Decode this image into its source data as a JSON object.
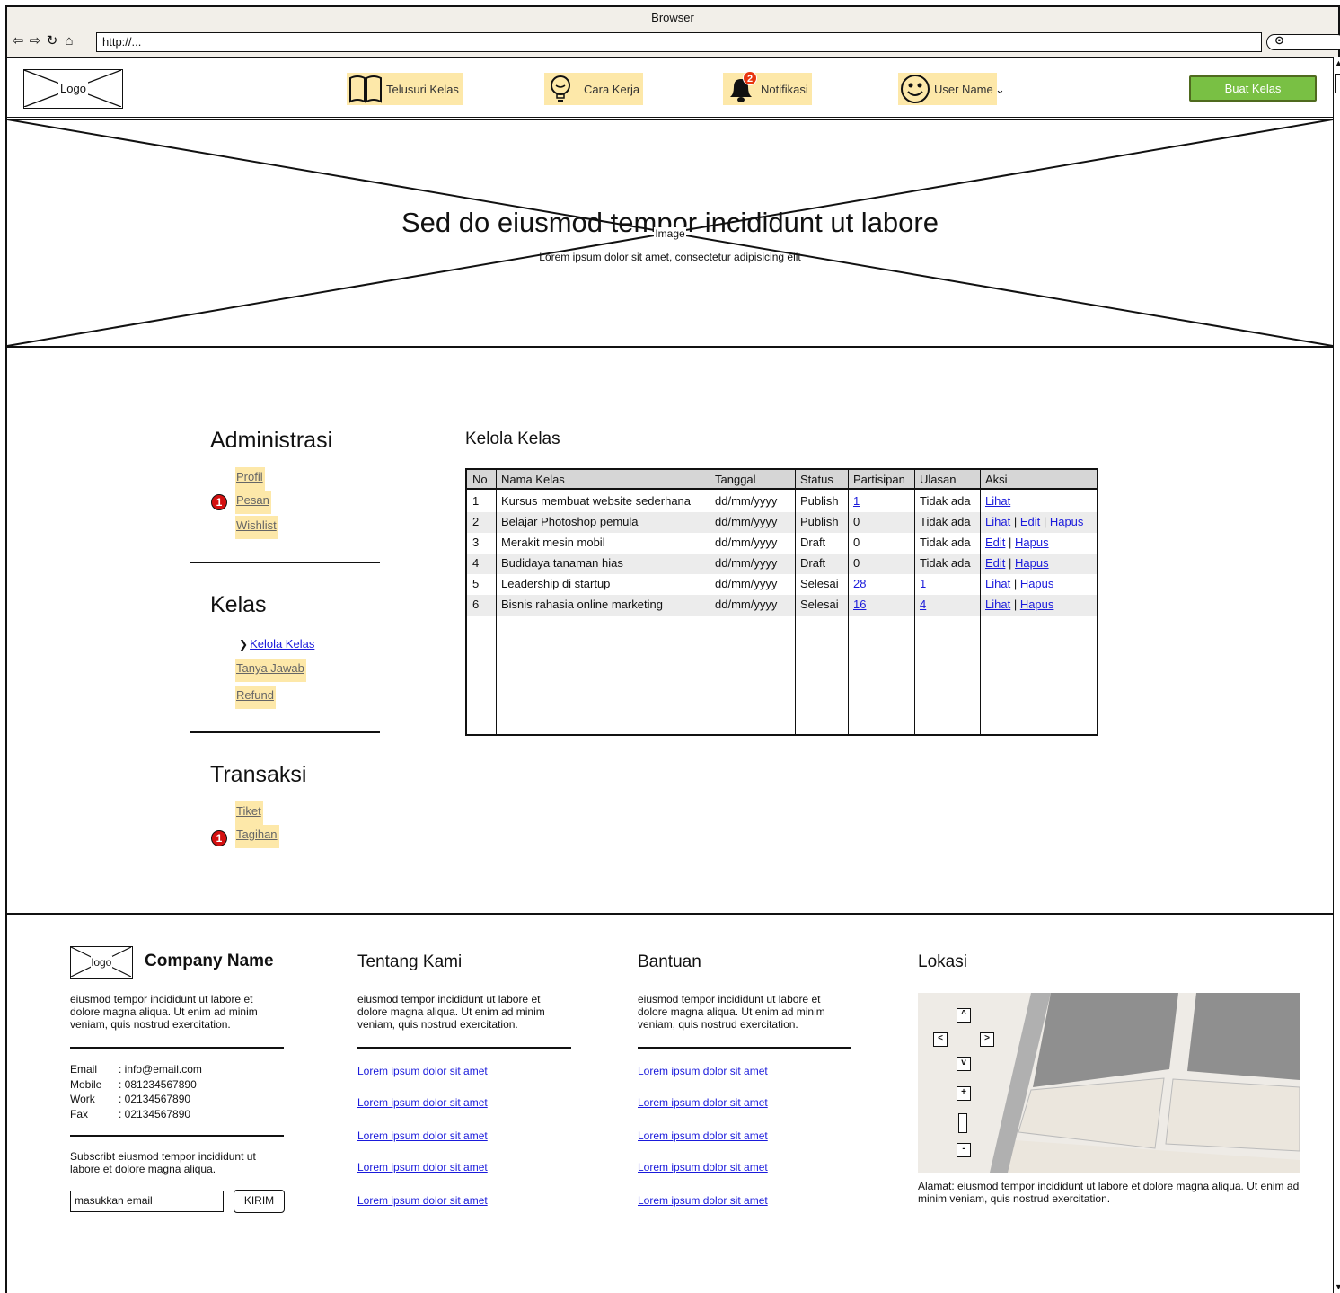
{
  "browser": {
    "title": "Browser",
    "url": "http://...",
    "nav_icons": [
      "back-arrow-icon",
      "forward-arrow-icon",
      "reload-icon",
      "home-icon"
    ],
    "search_icon": "search-icon"
  },
  "header": {
    "logo": "Logo",
    "nav": [
      {
        "label": "Telusuri Kelas",
        "icon": "book-icon"
      },
      {
        "label": "Cara Kerja",
        "icon": "lightbulb-icon"
      },
      {
        "label": "Notifikasi",
        "icon": "bell-icon",
        "badge": "2"
      },
      {
        "label": "User Name",
        "icon": "smiley-icon"
      }
    ],
    "cta": "Buat Kelas",
    "colors": {
      "nav_highlight": "#fde8a9",
      "cta": "#79c044",
      "badge": "#e8350f"
    }
  },
  "hero": {
    "title": "Sed do eiusmod tempor incididunt ut labore",
    "image_label": "Image",
    "subtitle": "Lorem ipsum dolor sit amet, consectetur adipisicing elit"
  },
  "sidebar": {
    "sections": [
      {
        "title": "Administrasi",
        "items": [
          {
            "label": "Profil"
          },
          {
            "label": "Pesan",
            "badge": "1"
          },
          {
            "label": "Wishlist"
          }
        ]
      },
      {
        "title": "Kelas",
        "items": [
          {
            "label": "Kelola Kelas",
            "active": true
          },
          {
            "label": "Tanya Jawab"
          },
          {
            "label": "Refund"
          }
        ]
      },
      {
        "title": "Transaksi",
        "items": [
          {
            "label": "Tiket"
          },
          {
            "label": "Tagihan",
            "badge": "1"
          }
        ]
      }
    ]
  },
  "main": {
    "title": "Kelola Kelas",
    "table": {
      "headers": [
        "No",
        "Nama Kelas",
        "Tanggal",
        "Status",
        "Partisipan",
        "Ulasan",
        "Aksi"
      ],
      "rows": [
        {
          "no": "1",
          "nama": "Kursus membuat website sederhana",
          "tanggal": "dd/mm/yyyy",
          "status": "Publish",
          "partisipan": "1",
          "ulasan": "Tidak ada",
          "aksi": [
            "Lihat"
          ]
        },
        {
          "no": "2",
          "nama": "Belajar Photoshop pemula",
          "tanggal": "dd/mm/yyyy",
          "status": "Publish",
          "partisipan": "0",
          "ulasan": "Tidak ada",
          "aksi": [
            "Lihat",
            "Edit",
            "Hapus"
          ]
        },
        {
          "no": "3",
          "nama": "Merakit mesin mobil",
          "tanggal": "dd/mm/yyyy",
          "status": "Draft",
          "partisipan": "0",
          "ulasan": "Tidak ada",
          "aksi": [
            "Edit",
            "Hapus"
          ]
        },
        {
          "no": "4",
          "nama": "Budidaya tanaman hias",
          "tanggal": "dd/mm/yyyy",
          "status": "Draft",
          "partisipan": "0",
          "ulasan": "Tidak ada",
          "aksi": [
            "Edit",
            "Hapus"
          ]
        },
        {
          "no": "5",
          "nama": "Leadership di startup",
          "tanggal": "dd/mm/yyyy",
          "status": "Selesai",
          "partisipan": "28",
          "ulasan": "1",
          "aksi": [
            "Lihat",
            "Hapus"
          ]
        },
        {
          "no": "6",
          "nama": "Bisnis rahasia online marketing",
          "tanggal": "dd/mm/yyyy",
          "status": "Selesai",
          "partisipan": "16",
          "ulasan": "4",
          "aksi": [
            "Lihat",
            "Hapus"
          ]
        }
      ]
    }
  },
  "footer": {
    "logo": "logo",
    "company": "Company Name",
    "about": "eiusmod tempor incididunt ut labore et dolore magna aliqua. Ut enim ad minim veniam, quis nostrud exercitation.",
    "contacts": [
      {
        "key": "Email",
        "value": ": info@email.com"
      },
      {
        "key": "Mobile",
        "value": ": 081234567890"
      },
      {
        "key": "Work",
        "value": ": 02134567890"
      },
      {
        "key": "Fax",
        "value": ": 02134567890"
      }
    ],
    "subscribe_text": "Subscribt eiusmod tempor incididunt ut labore et dolore magna aliqua.",
    "email_placeholder": "masukkan email",
    "submit": "KIRIM",
    "columns": [
      {
        "title": "Tentang Kami",
        "text": "eiusmod tempor incididunt ut labore et dolore magna aliqua. Ut enim ad minim veniam, quis nostrud exercitation.",
        "links": [
          "Lorem ipsum dolor sit amet",
          "Lorem ipsum dolor sit amet",
          "Lorem ipsum dolor sit amet",
          "Lorem ipsum dolor sit amet",
          "Lorem ipsum dolor sit amet"
        ]
      },
      {
        "title": "Bantuan",
        "text": "eiusmod tempor incididunt ut labore et dolore magna aliqua. Ut enim ad minim veniam, quis nostrud exercitation.",
        "links": [
          "Lorem ipsum dolor sit amet",
          "Lorem ipsum dolor sit amet",
          "Lorem ipsum dolor sit amet",
          "Lorem ipsum dolor sit amet",
          "Lorem ipsum dolor sit amet"
        ]
      }
    ],
    "location": {
      "title": "Lokasi",
      "address": "Alamat: eiusmod tempor incididunt ut labore et dolore magna aliqua. Ut enim ad minim veniam, quis nostrud exercitation."
    }
  }
}
